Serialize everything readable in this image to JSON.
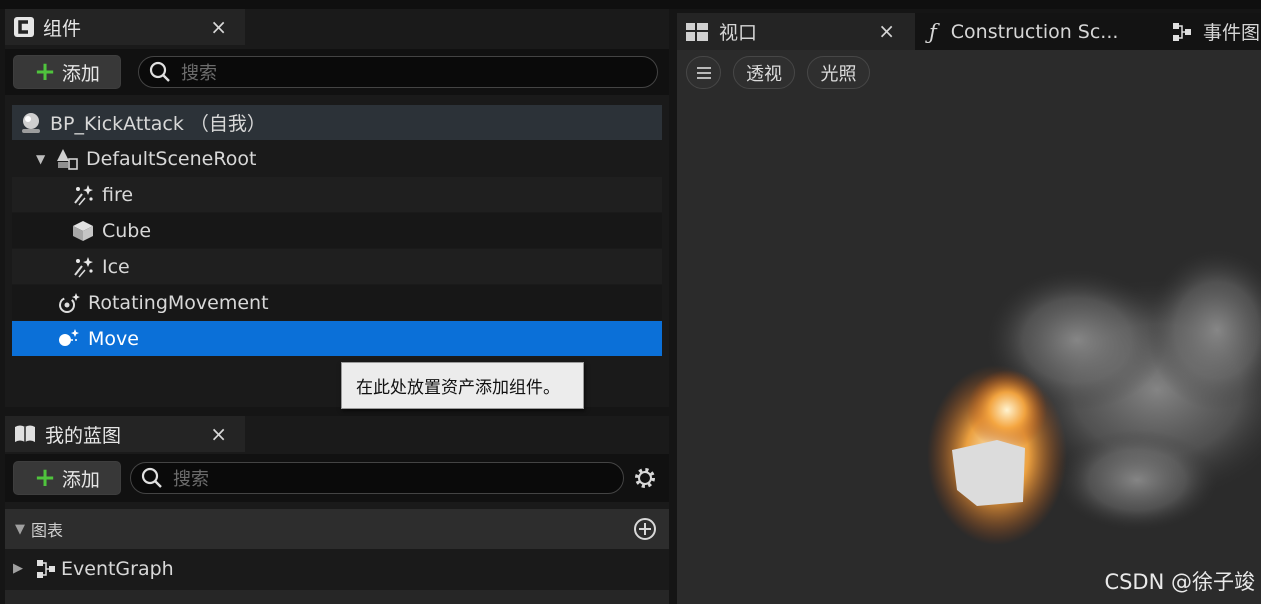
{
  "components_panel": {
    "tab_title": "组件",
    "close": "×",
    "add_label": "添加",
    "search_placeholder": "搜索",
    "tree": [
      {
        "label": "BP_KickAttack （自我）",
        "icon": "actor-icon",
        "indent": 0
      },
      {
        "label": "DefaultSceneRoot",
        "icon": "scene-root-icon",
        "indent": 1
      },
      {
        "label": "fire",
        "icon": "particle-icon",
        "indent": 2
      },
      {
        "label": "Cube",
        "icon": "cube-icon",
        "indent": 2
      },
      {
        "label": "Ice",
        "icon": "particle-icon",
        "indent": 2
      },
      {
        "label": "RotatingMovement",
        "icon": "rotating-movement-icon",
        "indent": 1
      },
      {
        "label": "Move",
        "icon": "movement-icon",
        "indent": 1,
        "selected": true
      }
    ],
    "tooltip": "在此处放置资产添加组件。"
  },
  "blueprint_panel": {
    "tab_title": "我的蓝图",
    "close": "×",
    "add_label": "添加",
    "search_placeholder": "搜索",
    "section_label": "图表",
    "items": [
      {
        "label": "EventGraph"
      }
    ]
  },
  "viewport": {
    "tabs": [
      {
        "label": "视口",
        "icon": "viewport-icon"
      },
      {
        "label": "Construction Sc...",
        "icon": "function-icon"
      },
      {
        "label": "事件图",
        "icon": "graph-icon"
      }
    ],
    "close": "×",
    "toolbar": {
      "perspective": "透视",
      "lighting": "光照"
    },
    "watermark": "CSDN @徐子竣"
  },
  "colors": {
    "selected": "#0b70d8",
    "accent_green": "#4fc43d"
  }
}
